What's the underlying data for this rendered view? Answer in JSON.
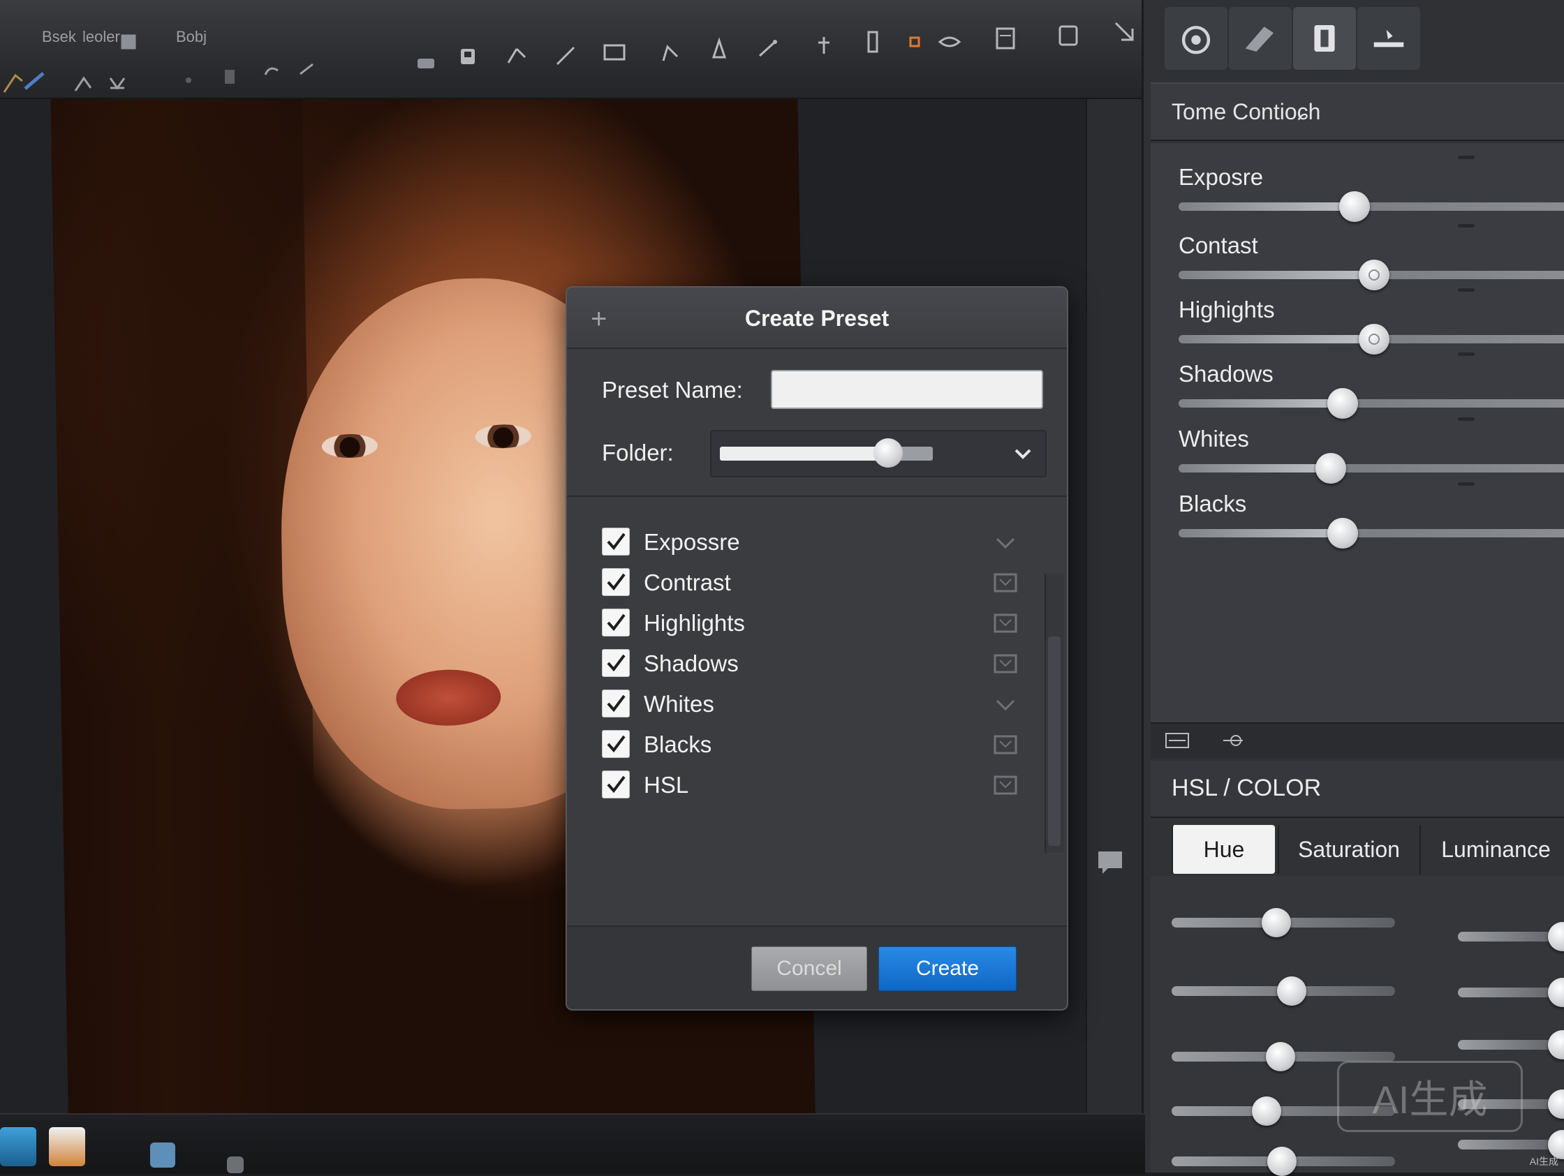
{
  "toolbar": {
    "menu": [
      "Bsek",
      "leoler",
      "Bobj"
    ],
    "tools": [
      "selection-icon",
      "brush-icon",
      "feather-icon",
      "lasso-icon",
      "spot-icon",
      "stamp-icon",
      "undo-icon",
      "redo-icon",
      "patch-icon",
      "save-icon",
      "pen-icon",
      "line-icon",
      "crop-icon",
      "angle-icon",
      "shape-icon",
      "wand-icon",
      "pin-icon",
      "rect-icon",
      "square-icon",
      "eye-icon",
      "doc-icon",
      "layer-icon",
      "arrow-icon"
    ]
  },
  "panel": {
    "tone_title": "Tome Contioɕh",
    "sliders": [
      {
        "label": "Exposre",
        "value": 0.45
      },
      {
        "label": "Contast",
        "value": 0.5
      },
      {
        "label": "Highights",
        "value": 0.5
      },
      {
        "label": "Shadows",
        "value": 0.42
      },
      {
        "label": "Whites",
        "value": 0.39
      },
      {
        "label": "Blacks",
        "value": 0.42
      }
    ],
    "hsl_title": "HSL / COLOR",
    "hsl_tabs": [
      "Hue",
      "Saturation",
      "Luminance"
    ],
    "hsl_active_tab": "Hue"
  },
  "dialog": {
    "title": "Create Preset",
    "preset_name_label": "Preset Name:",
    "preset_name_value": "",
    "folder_label": "Folder:",
    "options": [
      {
        "label": "Expossre",
        "checked": true
      },
      {
        "label": "Contrast",
        "checked": true
      },
      {
        "label": "Highlights",
        "checked": true
      },
      {
        "label": "Shadows",
        "checked": true
      },
      {
        "label": "Whites",
        "checked": true
      },
      {
        "label": "Blacks",
        "checked": true
      },
      {
        "label": "HSL",
        "checked": true
      }
    ],
    "cancel_label": "Concel",
    "create_label": "Create"
  },
  "watermark": {
    "text": "AI生成",
    "corner_text": "AI生成"
  },
  "colors": {
    "accent": "#1577d8",
    "panel_bg": "#3a3c41",
    "dialog_bg": "#3a3c40"
  }
}
